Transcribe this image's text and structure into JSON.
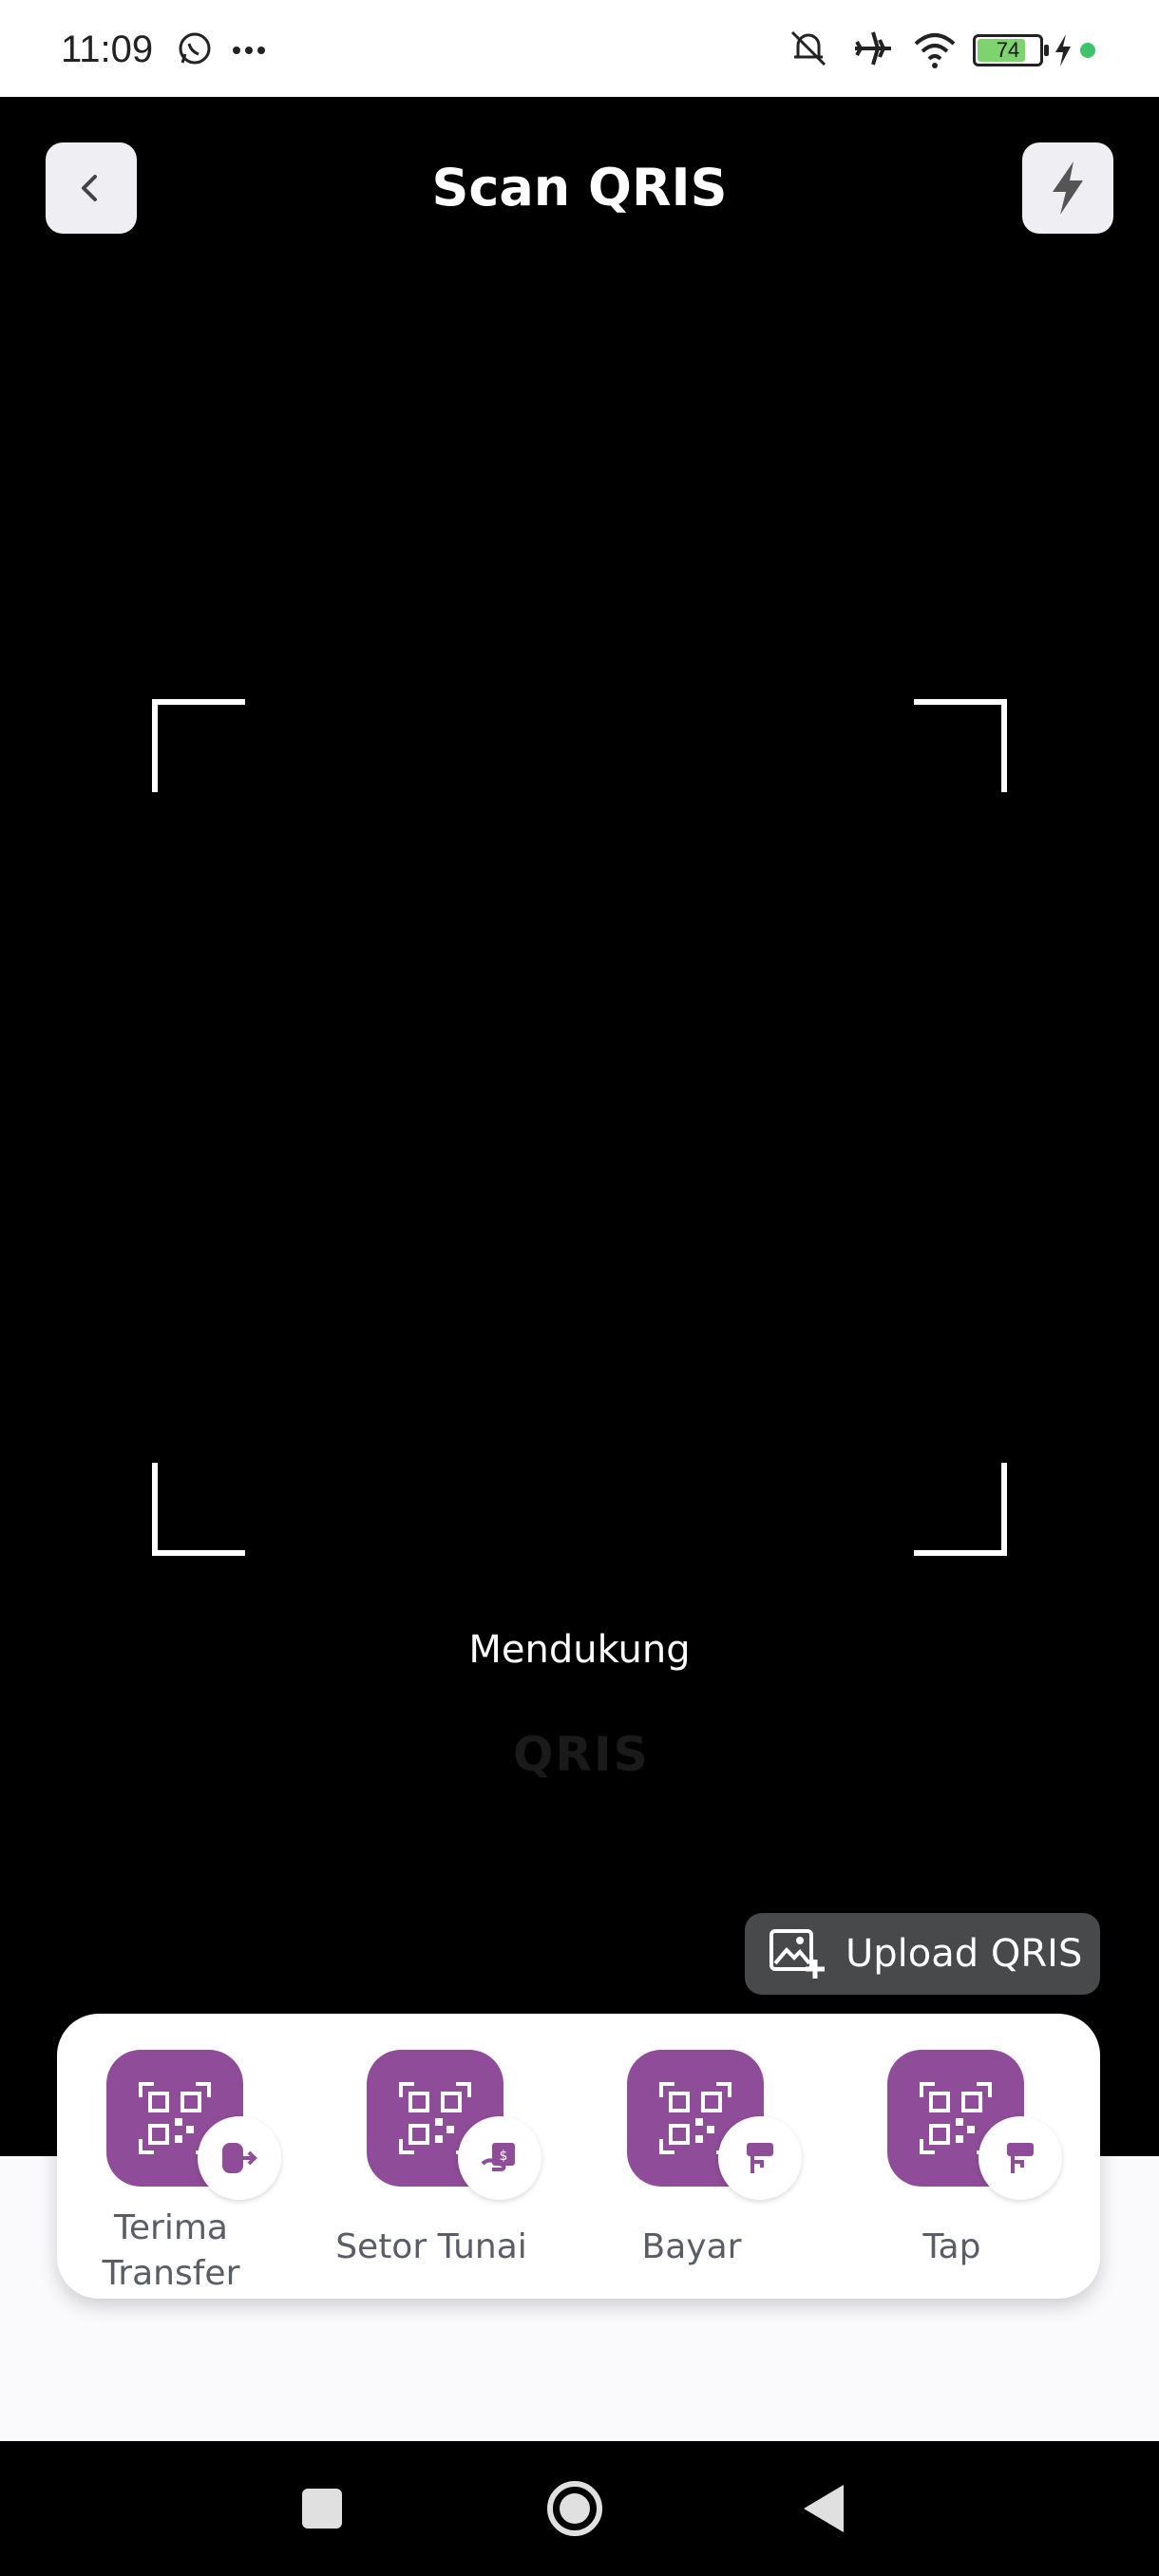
{
  "status_bar": {
    "time": "11:09",
    "battery": "74",
    "icons": [
      "whatsapp-icon",
      "more-icon",
      "mute-icon",
      "airplane-icon",
      "wifi-icon",
      "battery-icon",
      "charging-icon",
      "dot-icon"
    ]
  },
  "header": {
    "title": "Scan QRIS",
    "back_icon": "chevron-left-icon",
    "flash_icon": "flash-icon"
  },
  "scanner": {
    "support_text": "Mendukung",
    "logo_text": "QRIS"
  },
  "upload": {
    "label": "Upload QRIS",
    "icon": "image-add-icon"
  },
  "menu": {
    "items": [
      {
        "label_line1": "Terima",
        "label_line2": "Transfer",
        "badge_icon": "transfer-out-icon"
      },
      {
        "label": "Setor Tunai",
        "badge_icon": "cash-deposit-icon"
      },
      {
        "label": "Bayar",
        "badge_icon": "pay-icon"
      },
      {
        "label": "Tap",
        "badge_icon": "tap-icon"
      }
    ]
  },
  "colors": {
    "accent": "#8f4c98",
    "upload_bg": "#48494b"
  },
  "nav": {
    "icons": [
      "recents-square-icon",
      "home-circle-icon",
      "back-triangle-icon"
    ]
  }
}
